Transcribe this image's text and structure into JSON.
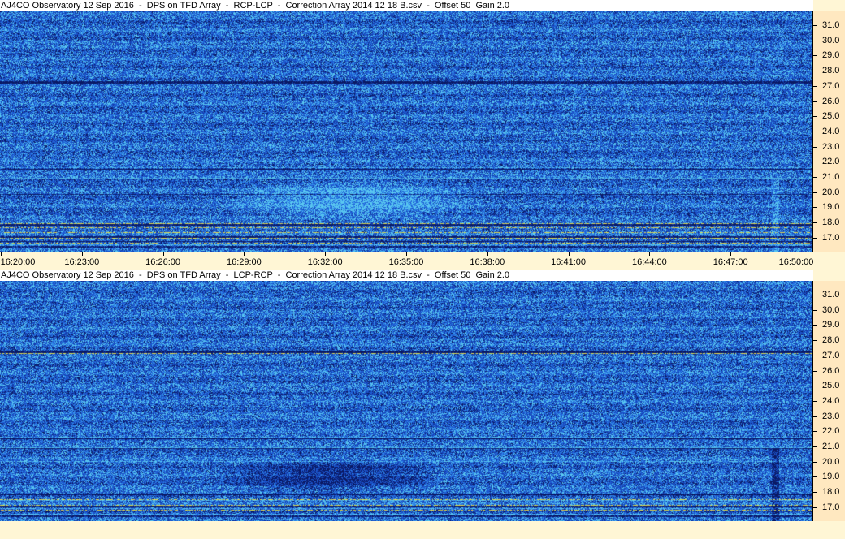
{
  "panels": [
    {
      "title": "AJ4CO Observatory 12 Sep 2016  -  DPS on TFD Array  -  RCP-LCP  -  Correction Array 2014 12 18 B.csv  -  Offset 50  Gain 2.0",
      "freq_labels": [
        "31.0",
        "30.0",
        "29.0",
        "28.0",
        "27.0",
        "26.0",
        "25.0",
        "24.0",
        "23.0",
        "22.0",
        "21.0",
        "20.0",
        "19.0",
        "18.0",
        "17.0"
      ]
    },
    {
      "title": "AJ4CO Observatory 12 Sep 2016  -  DPS on TFD Array  -  LCP-RCP  -  Correction Array 2014 12 18 B.csv  -  Offset 50  Gain 2.0",
      "freq_labels": [
        "31.0",
        "30.0",
        "29.0",
        "28.0",
        "27.0",
        "26.0",
        "25.0",
        "24.0",
        "23.0",
        "22.0",
        "21.0",
        "20.0",
        "19.0",
        "18.0",
        "17.0"
      ]
    }
  ],
  "time_axis": {
    "labels": [
      "16:20:00",
      "16:23:00",
      "16:26:00",
      "16:29:00",
      "16:32:00",
      "16:35:00",
      "16:38:00",
      "16:41:00",
      "16:44:00",
      "16:47:00",
      "16:50:00"
    ]
  },
  "colors": {
    "background": "#FFF6D5",
    "axis_background": "#FFE8C0",
    "spectrogram_base": "#1E55C8",
    "spectrogram_dark": "#0A1E6E",
    "spectrogram_bright": "#4FB8F0",
    "hot_yellow": "#E8E060"
  }
}
